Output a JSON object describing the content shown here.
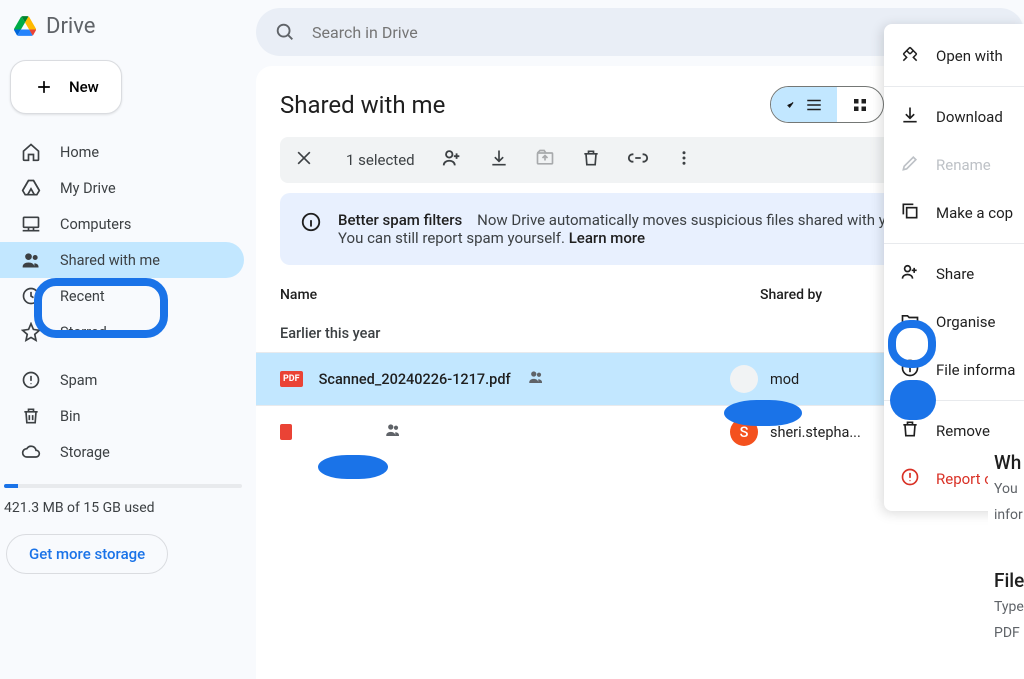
{
  "brand": "Drive",
  "new_label": "New",
  "sidebar": {
    "items": [
      {
        "label": "Home",
        "icon": "home"
      },
      {
        "label": "My Drive",
        "icon": "drive"
      },
      {
        "label": "Computers",
        "icon": "computer"
      },
      {
        "label": "Shared with me",
        "icon": "people"
      },
      {
        "label": "Recent",
        "icon": "clock"
      },
      {
        "label": "Starred",
        "icon": "star"
      },
      {
        "label": "Spam",
        "icon": "spam"
      },
      {
        "label": "Bin",
        "icon": "bin"
      },
      {
        "label": "Storage",
        "icon": "cloud"
      }
    ],
    "storage_text": "421.3 MB of 15 GB used",
    "more_storage": "Get more storage"
  },
  "search": {
    "placeholder": "Search in Drive"
  },
  "page_title": "Shared with me",
  "toolbar": {
    "selected_text": "1 selected"
  },
  "banner": {
    "title": "Better spam filters",
    "body_a": "Now Drive automatically moves suspicious files shared with you to spam. You can still report spam yourself. ",
    "learn_more": "Learn more"
  },
  "columns": {
    "name": "Name",
    "shared_by": "Shared by"
  },
  "group_label": "Earlier this year",
  "rows": [
    {
      "file": "Scanned_20240226-1217.pdf",
      "shared_by": "mod",
      "selected": true,
      "avatar_bg": "#f1f3f4"
    },
    {
      "file": "",
      "shared_by": "sheri.stepha...",
      "selected": false,
      "avatar_bg": "#f4511e",
      "avatar_initial": "S"
    }
  ],
  "ctx": {
    "open_with": "Open with",
    "download": "Download",
    "rename": "Rename",
    "make_copy": "Make a cop",
    "share": "Share",
    "organise": "Organise",
    "file_info": "File informa",
    "remove": "Remove",
    "report": "Report or b"
  },
  "right_panel": {
    "h1": "Wh",
    "l1": "You ",
    "l2": "infor",
    "h2": "File",
    "l3": "Type",
    "l4": "PDF"
  }
}
